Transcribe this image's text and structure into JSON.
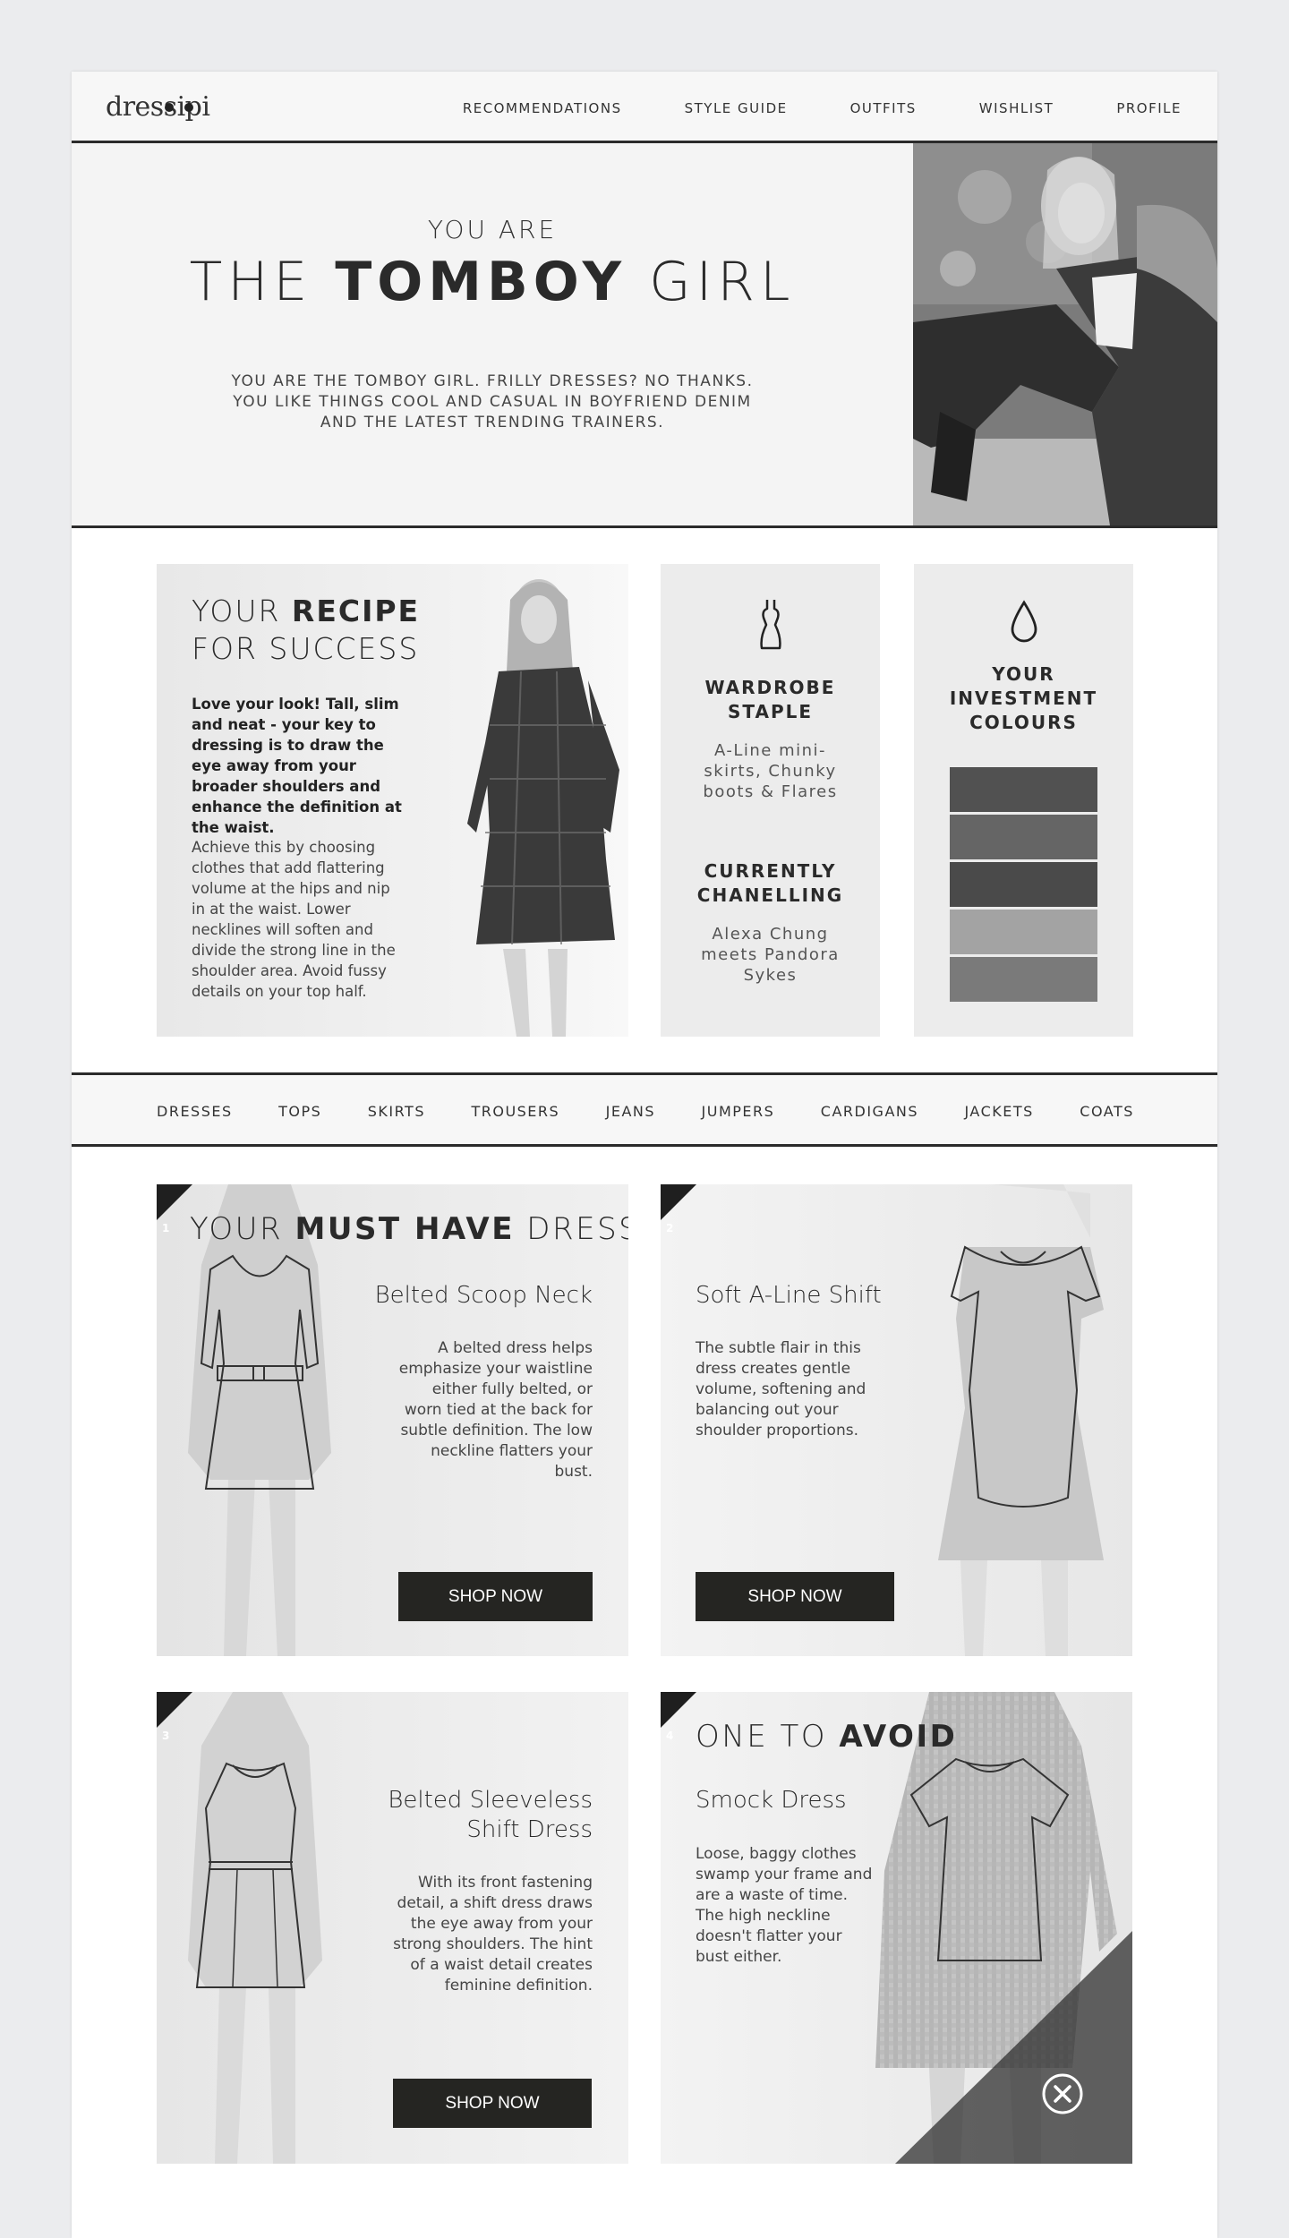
{
  "brand": {
    "logo_text": "dressipi"
  },
  "nav": {
    "items": [
      "RECOMMENDATIONS",
      "STYLE GUIDE",
      "OUTFITS",
      "WISHLIST",
      "PROFILE"
    ]
  },
  "hero": {
    "pre_title": "YOU ARE",
    "title_start": "THE",
    "title_bold": "TOMBOY",
    "title_end": "GIRL",
    "description": "YOU ARE THE TOMBOY GIRL. FRILLY DRESSES? NO THANKS. YOU LIKE THINGS COOL AND CASUAL IN BOYFRIEND DENIM AND THE LATEST TRENDING TRAINERS."
  },
  "recipe": {
    "title_line1_light": "YOUR",
    "title_line1_bold": "RECIPE",
    "title_line2": "FOR SUCCESS",
    "lead": "Love your look! Tall, slim and neat - your key to dressing is to draw the eye away from your broader shoulders and enhance the definition at the waist.",
    "body": "Achieve this by choosing clothes that add flattering volume at the hips and nip in at the waist. Lower necklines will soften and divide the strong line in the shoulder area. Avoid fussy details on your top half."
  },
  "staple": {
    "icon": "dress-icon",
    "heading": "WARDROBE STAPLE",
    "text": "A-Line mini-skirts, Chunky boots & Flares",
    "heading2": "CURRENTLY CHANELLING",
    "text2": "Alexa Chung meets Pandora Sykes"
  },
  "colours": {
    "icon": "drop-icon",
    "heading": "YOUR INVESTMENT COLOURS",
    "swatches": [
      "#515151",
      "#656565",
      "#4a4a4a",
      "#a3a3a3",
      "#7a7a7a"
    ]
  },
  "categories": [
    "DRESSES",
    "TOPS",
    "SKIRTS",
    "TROUSERS",
    "JEANS",
    "JUMPERS",
    "CARDIGANS",
    "JACKETS",
    "COATS"
  ],
  "must_have": {
    "title_light": "YOUR",
    "title_bold": "MUST HAVE",
    "title_end": "DRESS"
  },
  "avoid": {
    "title_light": "ONE TO",
    "title_bold": "AVOID"
  },
  "products": [
    {
      "number": "1",
      "name": "Belted Scoop Neck",
      "description": "A belted dress helps emphasize your waistline either fully belted, or worn tied at the back for subtle definition. The low neckline flatters your bust.",
      "cta": "SHOP NOW"
    },
    {
      "number": "2",
      "name": "Soft A-Line Shift",
      "description": "The subtle flair in this dress creates gentle volume, softening and balancing out your shoulder proportions.",
      "cta": "SHOP NOW"
    },
    {
      "number": "3",
      "name": "Belted Sleeveless Shift Dress",
      "description": "With its front fastening detail, a shift dress draws the eye away from your strong shoulders. The hint of a waist detail creates feminine definition.",
      "cta": "SHOP NOW"
    },
    {
      "number": "4",
      "name": "Smock Dress",
      "description": "Loose, baggy clothes swamp your frame and are a waste of time. The high neckline doesn't flatter your bust either."
    }
  ]
}
